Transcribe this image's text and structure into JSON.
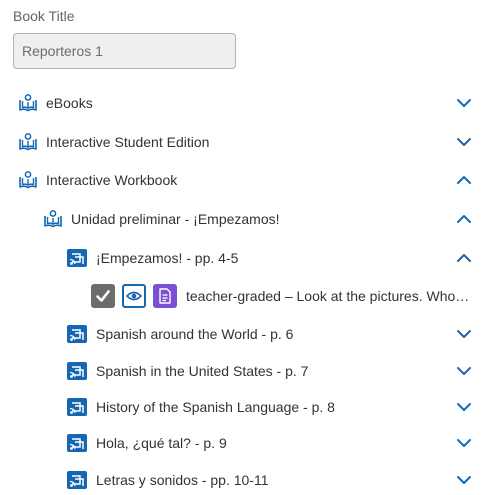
{
  "book_title": {
    "label": "Book Title",
    "value": "Reporteros 1"
  },
  "tree": {
    "items": [
      {
        "label": "eBooks",
        "expanded": false
      },
      {
        "label": "Interactive Student Edition",
        "expanded": false
      },
      {
        "label": "Interactive Workbook",
        "expanded": true
      },
      {
        "label": "Unidad preliminar - ¡Empezamos!",
        "expanded": true
      },
      {
        "label": "¡Empezamos! - pp. 4-5",
        "expanded": true
      },
      {
        "label": "Spanish around the World - p. 6",
        "expanded": false
      },
      {
        "label": "Spanish in the United States - p. 7",
        "expanded": false
      },
      {
        "label": "History of the Spanish Language - p. 8",
        "expanded": false
      },
      {
        "label": "Hola, ¿qué tal? - p. 9",
        "expanded": false
      },
      {
        "label": "Letras y sonidos - pp. 10-11",
        "expanded": false
      }
    ],
    "asset": {
      "text": "teacher-graded – Look at the pictures. Whom do you think they are greeting?",
      "icons": [
        "checkbox-checked-icon",
        "eye-icon",
        "document-icon"
      ]
    }
  },
  "colors": {
    "accent": "#1566b3",
    "purple": "#7b4fd6",
    "check_bg": "#6c6c6c"
  }
}
